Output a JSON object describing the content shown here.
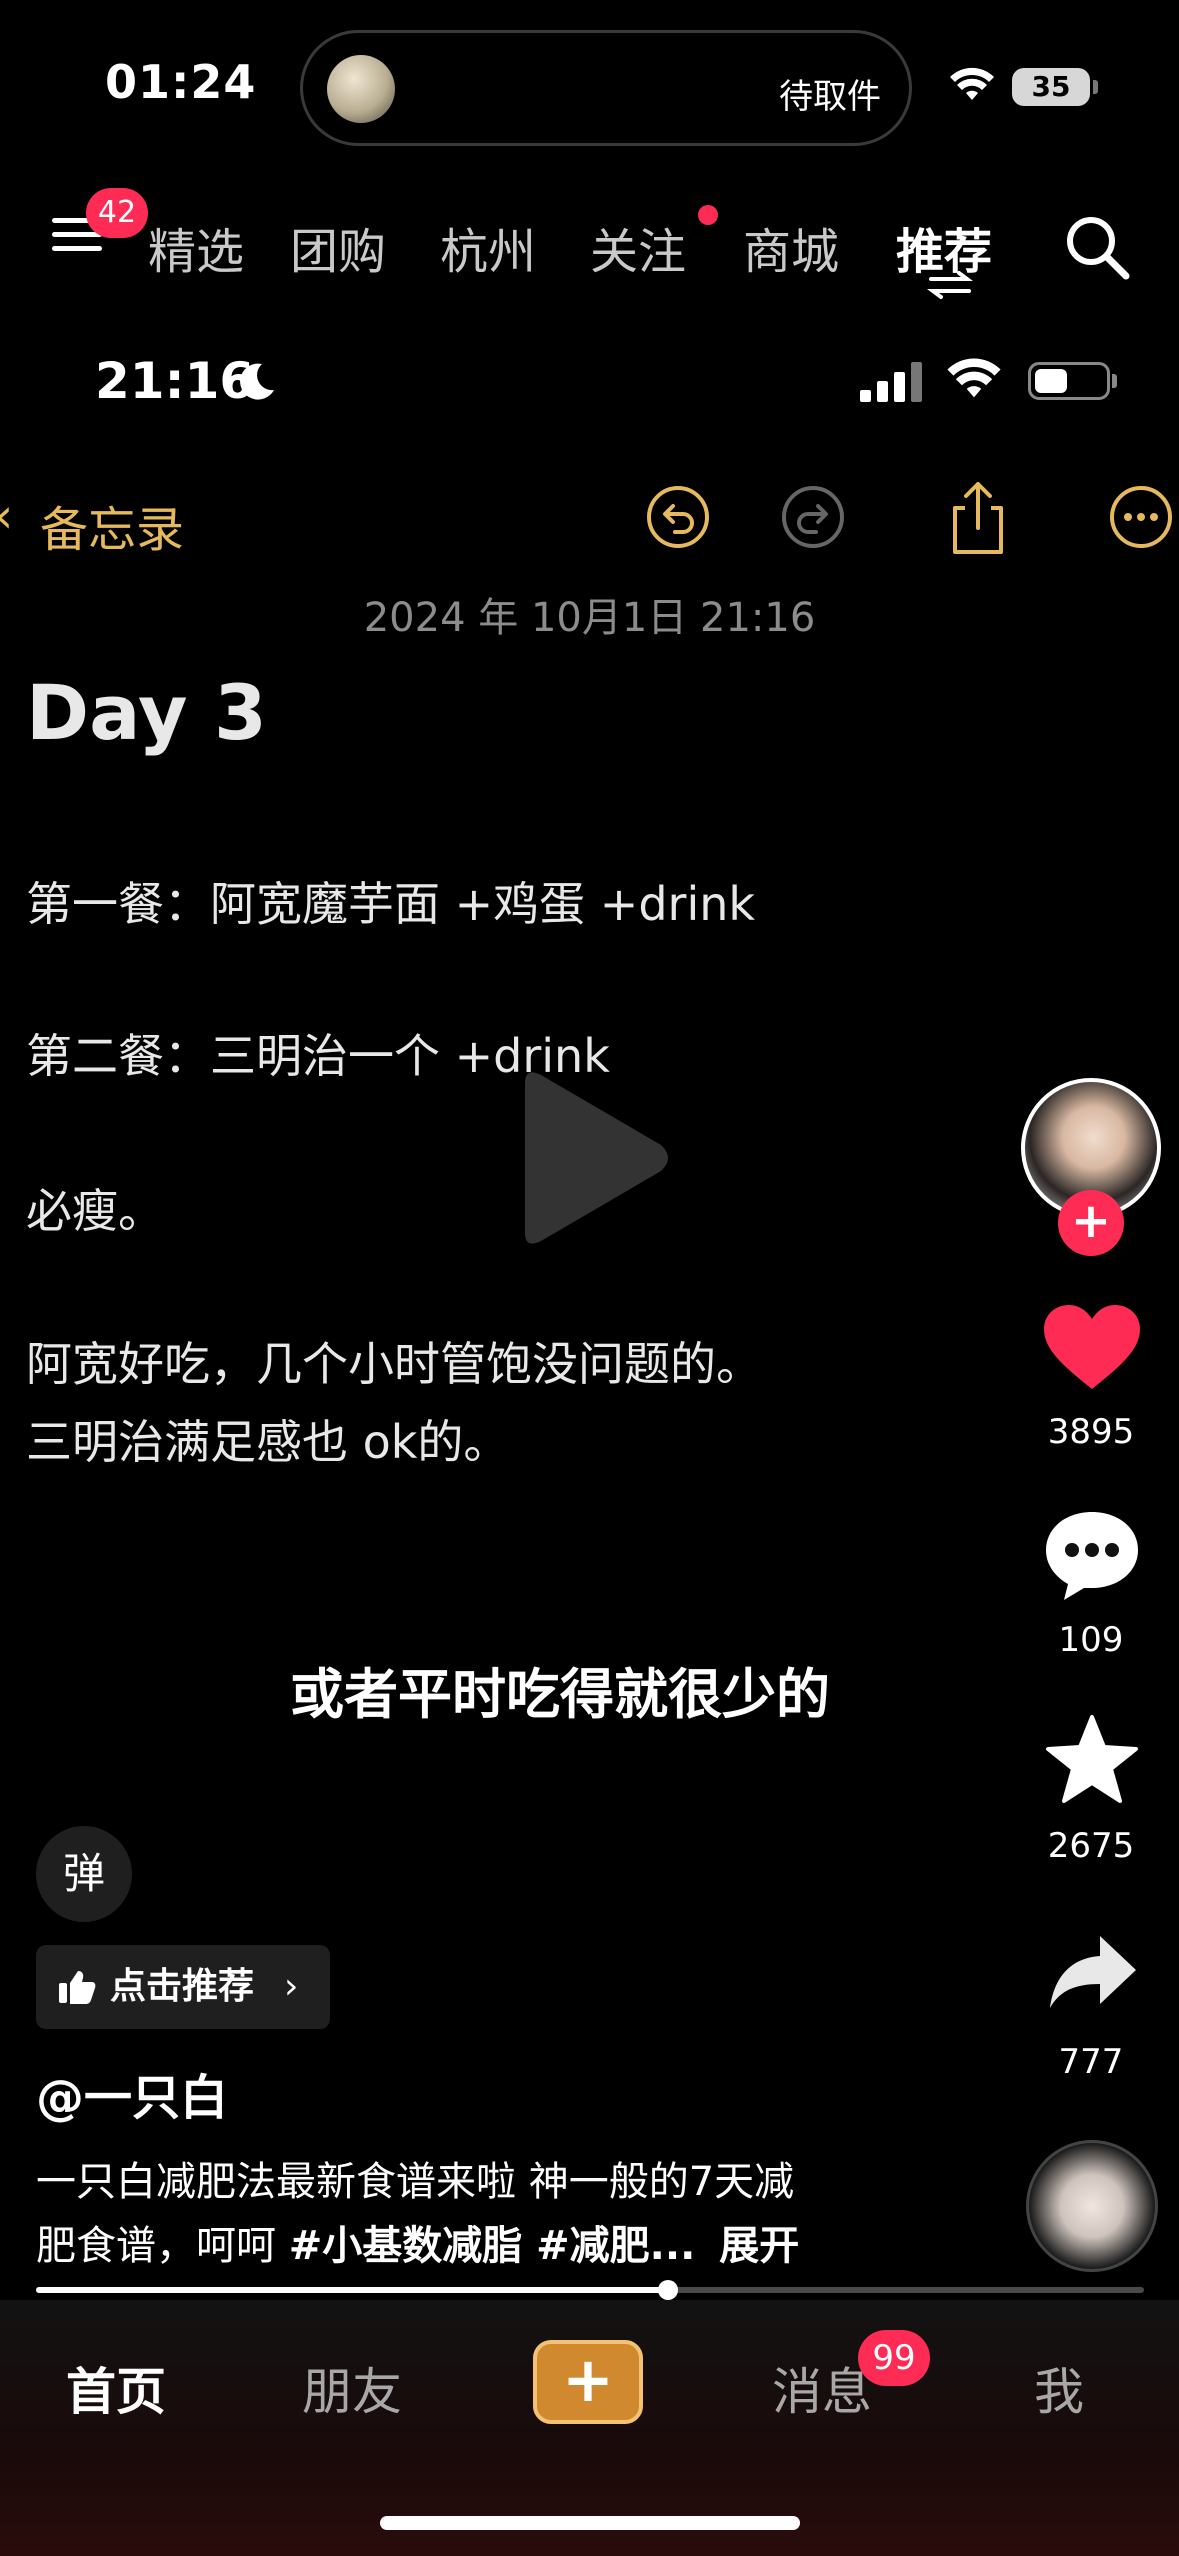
{
  "status_bar": {
    "time": "01:24",
    "island_text": "待取件",
    "battery": "35"
  },
  "top_nav": {
    "menu_badge": "42",
    "tabs": [
      {
        "label": "精选"
      },
      {
        "label": "团购"
      },
      {
        "label": "杭州"
      },
      {
        "label": "关注"
      },
      {
        "label": "商城"
      },
      {
        "label": "推荐"
      }
    ],
    "active_tab": "推荐"
  },
  "video": {
    "inner_status": {
      "time": "21:16"
    },
    "notes": {
      "back_label": "备忘录",
      "date": "2024 年 10月1日 21:16",
      "heading": "Day 3",
      "lines": [
        "第一餐：阿宽魔芋面 +鸡蛋 +drink",
        "第二餐：三明治一个 +drink",
        "必瘦。",
        "阿宽好吃，几个小时管饱没问题的。",
        "三明治满足感也 ok的。"
      ]
    },
    "subtitle": "或者平时吃得就很少的",
    "progress": 0.57
  },
  "side_actions": {
    "likes": "3895",
    "comments": "109",
    "favorites": "2675",
    "shares": "777"
  },
  "info": {
    "danmu_label": "弹",
    "recommend_label": "点击推荐",
    "author": "@一只白",
    "description_line1": "一只白减肥法最新食谱来啦 神一般的7天减",
    "description_line2_prefix": "肥食谱，呵呵 ",
    "hashtags": "#小基数减脂 #减肥...",
    "expand": "展开"
  },
  "bottom_tabs": {
    "home": "首页",
    "friends": "朋友",
    "messages": "消息",
    "messages_badge": "99",
    "me": "我"
  },
  "colors": {
    "accent_red": "#fe2c55",
    "notes_yellow": "#e6b95d",
    "plus_orange": "#d0892f"
  }
}
